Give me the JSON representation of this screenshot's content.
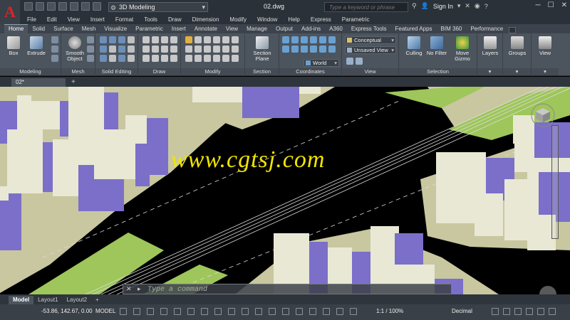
{
  "titlebar": {
    "app_letter": "A",
    "workspace": "3D Modeling",
    "document": "02.dwg",
    "search_placeholder": "Type a keyword or phrase",
    "signin": "Sign In"
  },
  "menu": [
    "File",
    "Edit",
    "View",
    "Insert",
    "Format",
    "Tools",
    "Draw",
    "Dimension",
    "Modify",
    "Window",
    "Help",
    "Express",
    "Parametric"
  ],
  "ribbon_tabs": [
    "Home",
    "Solid",
    "Surface",
    "Mesh",
    "Visualize",
    "Parametric",
    "Insert",
    "Annotate",
    "View",
    "Manage",
    "Output",
    "Add-ins",
    "A360",
    "Express Tools",
    "Featured Apps",
    "BIM 360",
    "Performance"
  ],
  "ribbon": {
    "box": "Box",
    "extrude": "Extrude",
    "smooth_object": "Smooth Object",
    "section_plane": "Section Plane",
    "culling": "Culling",
    "no_filter": "No Filter",
    "move_gizmo": "Move Gizmo",
    "layers": "Layers",
    "groups": "Groups",
    "view": "View",
    "visual_style": "Conceptual",
    "saved_view": "Unsaved View",
    "ucs": "World",
    "panels": {
      "modeling": "Modeling",
      "mesh": "Mesh",
      "solid_editing": "Solid Editing",
      "draw": "Draw",
      "modify": "Modify",
      "section": "Section",
      "coordinates": "Coordinates",
      "view": "View",
      "selection": "Selection"
    }
  },
  "file_tab": "02*",
  "viewport": {
    "watermark": "www.cgtsj.com",
    "command_placeholder": "Type a command"
  },
  "layout_tabs": [
    "Model",
    "Layout1",
    "Layout2"
  ],
  "status": {
    "coords": "-53.86, 142.67, 0.00",
    "mode": "MODEL",
    "scale": "1:1 / 100%",
    "units": "Decimal"
  },
  "colors": {
    "building_face": "#e8e8d4",
    "building_side": "#7b6fc9",
    "grass": "#9ec65a",
    "sidewalk": "#c8c7a0",
    "road": "#000000",
    "watermark": "#f2e400"
  }
}
